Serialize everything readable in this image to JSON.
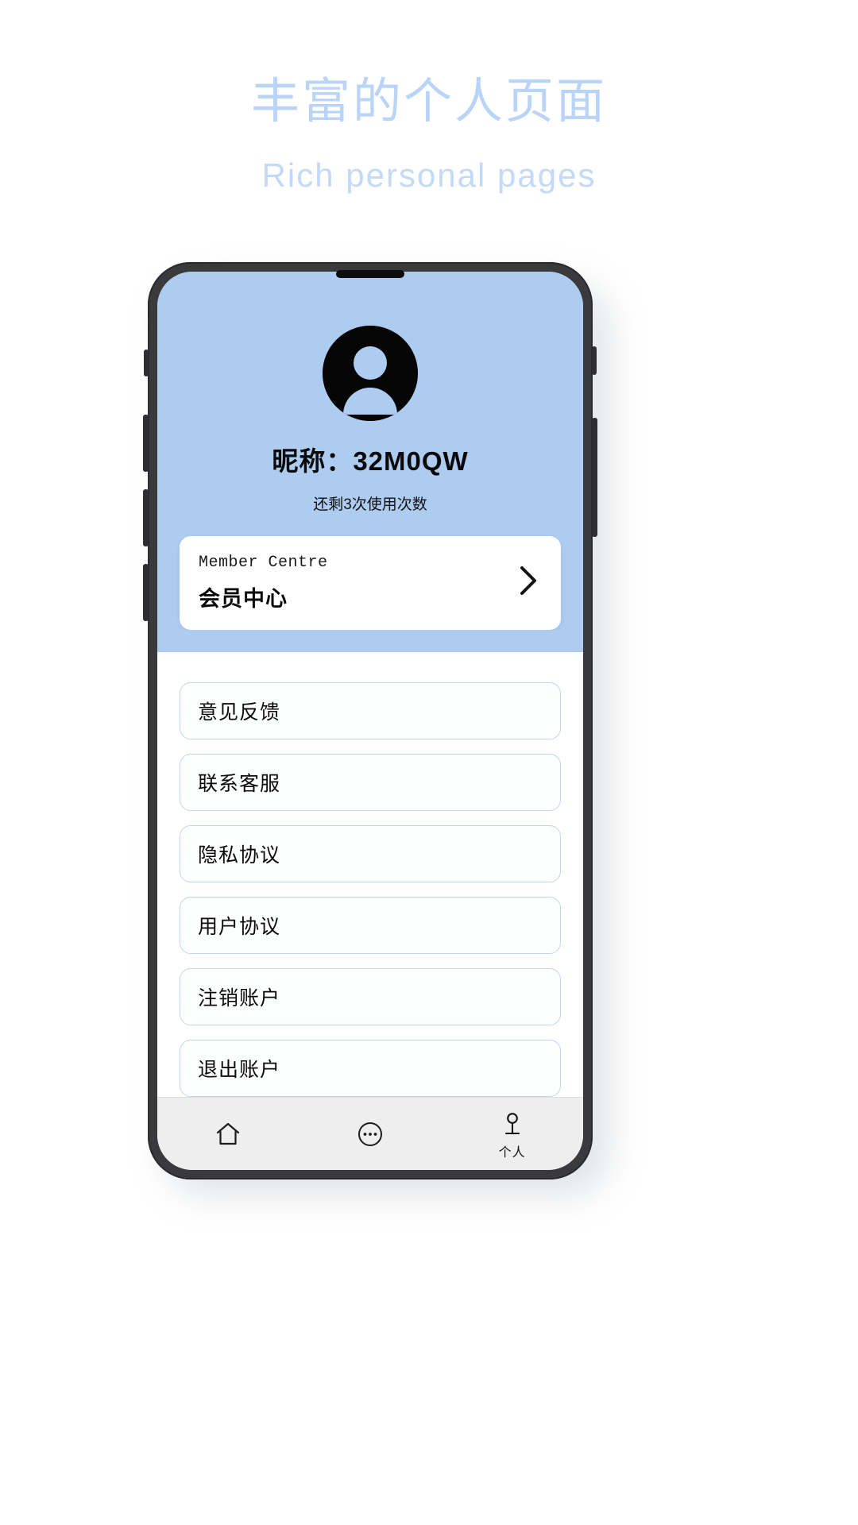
{
  "promo": {
    "title": "丰富的个人页面",
    "subtitle": "Rich personal pages",
    "title_color": "#b9d4f7",
    "subtitle_color": "#c3d9f8"
  },
  "phone": {
    "accent_color": "#aecbf0",
    "frame_color": "#3a3a3c"
  },
  "profile": {
    "avatar_icon": "person-avatar-icon",
    "nickname": "昵称：32M0QW",
    "usage_text": "还剩3次使用次数"
  },
  "member_card": {
    "title_en": "Member Centre",
    "title_cn": "会员中心",
    "chevron_icon": "chevron-right-icon"
  },
  "menu": {
    "items": [
      {
        "label": "意见反馈"
      },
      {
        "label": "联系客服"
      },
      {
        "label": "隐私协议"
      },
      {
        "label": "用户协议"
      },
      {
        "label": "注销账户"
      },
      {
        "label": "退出账户"
      }
    ]
  },
  "tabbar": {
    "items": [
      {
        "icon": "home-icon",
        "label": ""
      },
      {
        "icon": "ellipsis-circle-icon",
        "label": ""
      },
      {
        "icon": "person-icon",
        "label": "个人"
      }
    ],
    "active_index": 2
  }
}
